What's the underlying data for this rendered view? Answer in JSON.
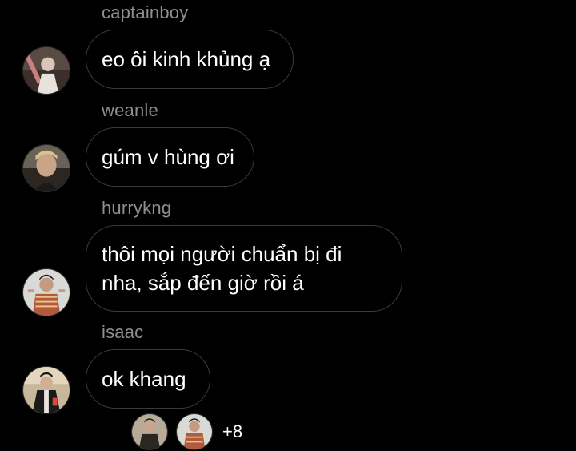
{
  "messages": [
    {
      "username": "captainboy",
      "text": "eo ôi kinh khủng ạ"
    },
    {
      "username": "weanle",
      "text": "gúm v hùng ơi"
    },
    {
      "username": "hurrykng",
      "text": "thôi mọi người chuẩn bị đi nha, sắp đến giờ rồi á"
    },
    {
      "username": "isaac",
      "text": "ok khang"
    }
  ],
  "seen": {
    "extra_count": "+8"
  }
}
